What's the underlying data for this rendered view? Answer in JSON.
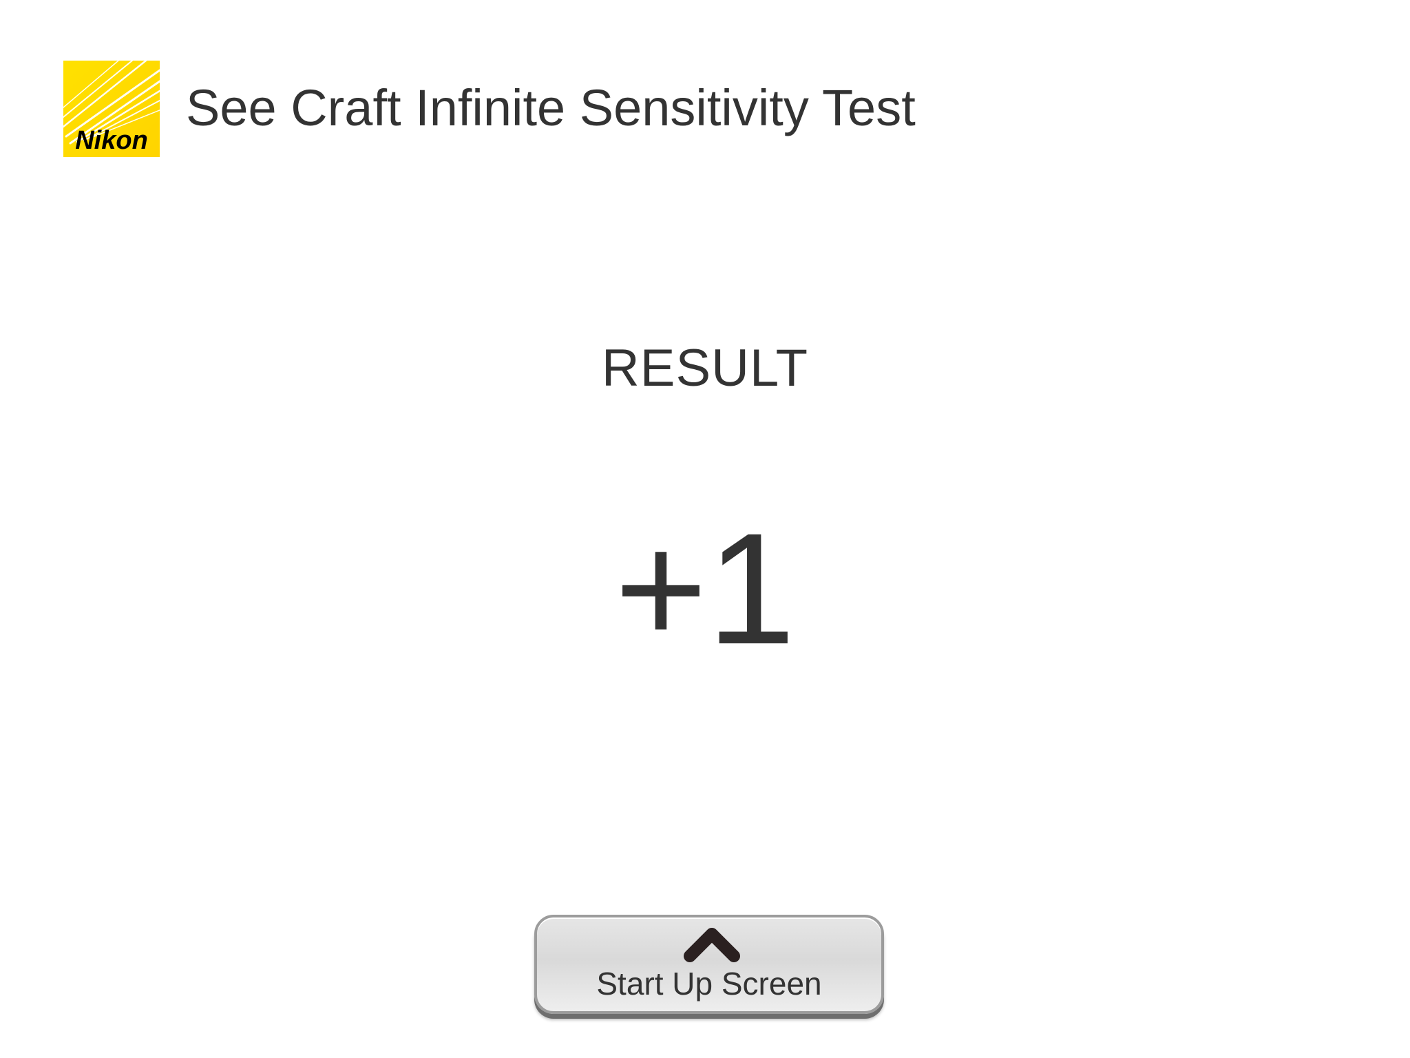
{
  "header": {
    "logo_text": "Nikon",
    "title": "See Craft Infinite Sensitivity Test"
  },
  "result": {
    "label": "RESULT",
    "value": "+1"
  },
  "footer": {
    "home_button_label": "Start Up Screen",
    "home_button_icon": "chevron-up-icon"
  },
  "colors": {
    "brand_yellow": "#FFE100",
    "text": "#333333",
    "button_face": "#DDDDDD",
    "button_border": "#9C9C9C"
  }
}
